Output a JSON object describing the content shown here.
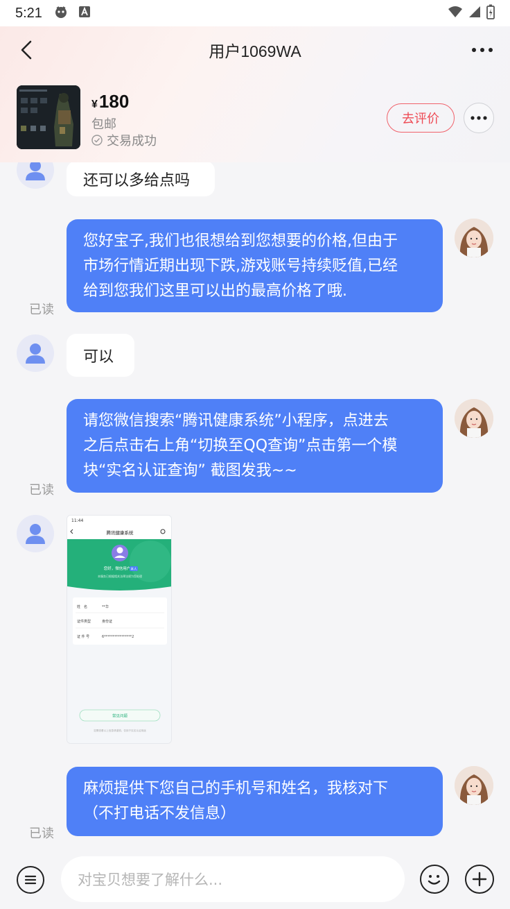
{
  "status_bar": {
    "time": "5:21"
  },
  "nav": {
    "title": "用户1069WA"
  },
  "product": {
    "currency": "¥",
    "price": "180",
    "shipping": "包邮",
    "status": "交易成功",
    "review_label": "去评价"
  },
  "messages": [
    {
      "id": "m1",
      "from": "user",
      "text": "还可以多给点吗"
    },
    {
      "id": "m2",
      "from": "agent",
      "lines": [
        "您好宝子,我们也很想给到您想要的价格,但由于",
        "市场行情近期出现下跌,游戏账号持续贬值,已经",
        "给到您我们这里可以出的最高价格了哦."
      ],
      "read": "已读"
    },
    {
      "id": "m3",
      "from": "user",
      "text": "可以"
    },
    {
      "id": "m4",
      "from": "agent",
      "lines": [
        "请您微信搜索“腾讯健康系统”小程序，点进去",
        "之后点击右上角“切换至QQ查询”点击第一个模",
        "块“实名认证查询” 截图发我~~"
      ],
      "read": "已读"
    },
    {
      "id": "m5",
      "from": "user",
      "type": "image",
      "screenshot": {
        "time": "11:44",
        "title": "腾讯健康系统",
        "greeting": "您好，微信用户",
        "badge": "本人",
        "hint": "本服务已根据相关法律法规为您处理",
        "rows": [
          {
            "label": "姓　名",
            "value": "**华"
          },
          {
            "label": "证件类型",
            "value": "身份证"
          },
          {
            "label": "证 件 号",
            "value": "6****************2"
          }
        ],
        "faq": "常见问题",
        "footer": "如需查看以上信息请谨慎，仅用于实名认证用途"
      }
    },
    {
      "id": "m6",
      "from": "agent",
      "lines": [
        "麻烦提供下您自己的手机号和姓名，我核对下",
        "（不打电话不发信息）"
      ],
      "read": "已读"
    }
  ],
  "input": {
    "placeholder": "对宝贝想要了解什么..."
  },
  "colors": {
    "accent": "#4f80f7",
    "review": "#ee4b55",
    "bg": "#f5f5f7"
  }
}
